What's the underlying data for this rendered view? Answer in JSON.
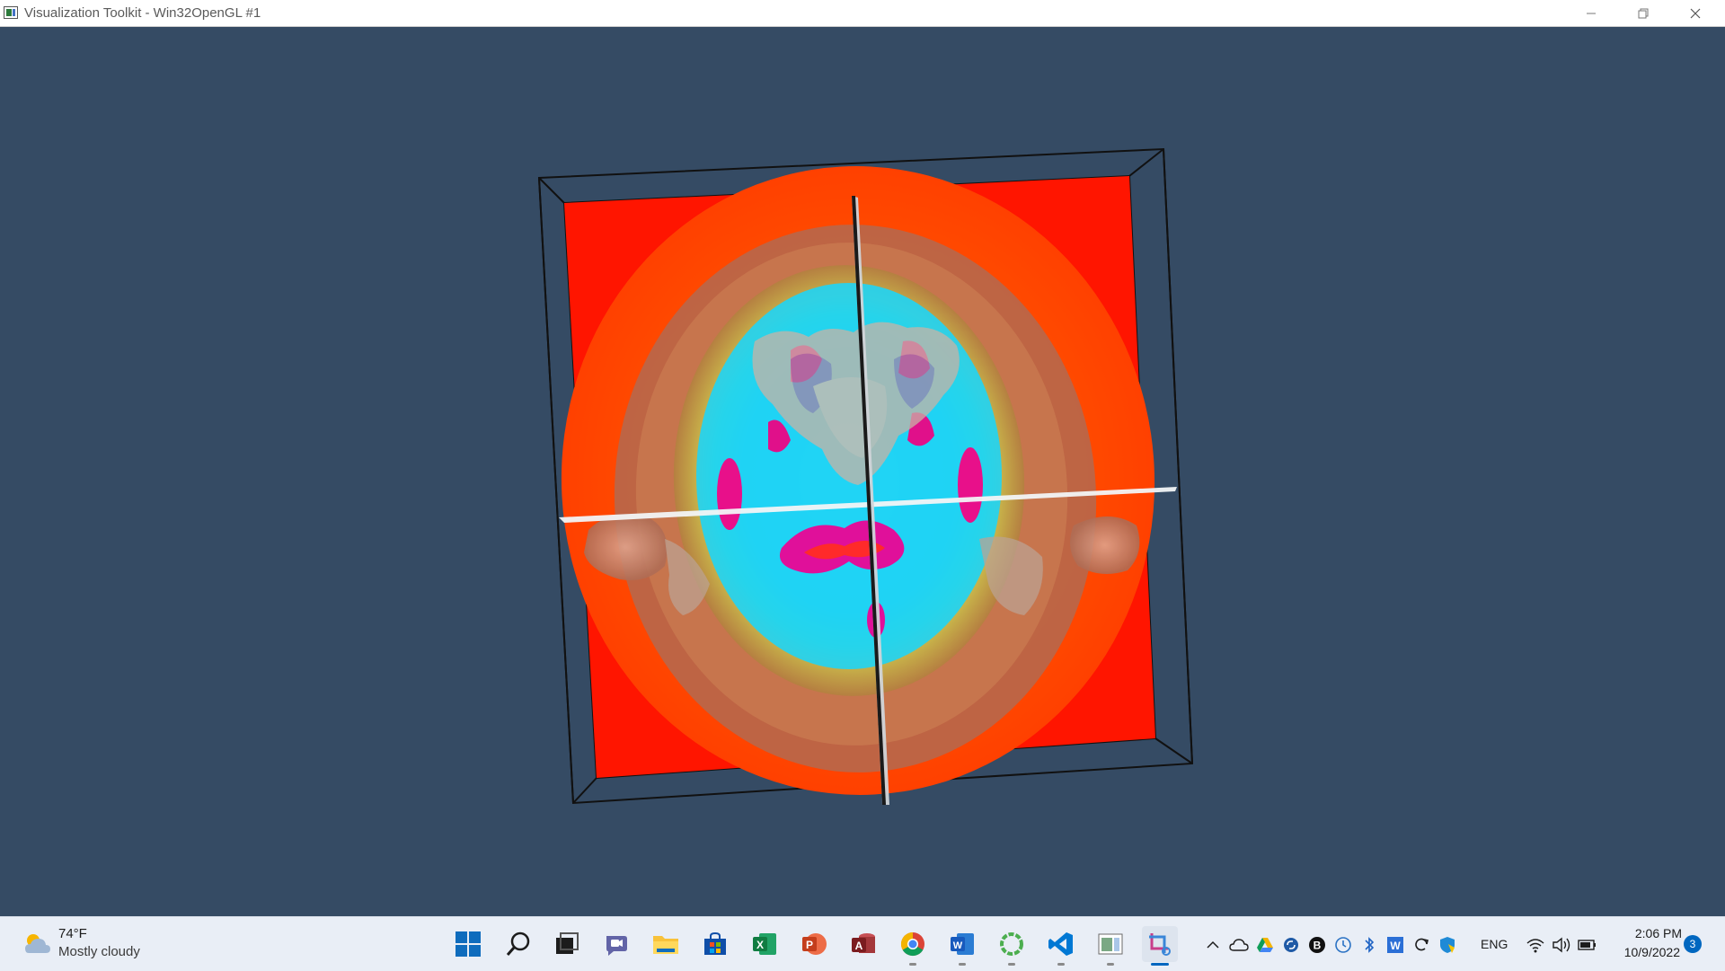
{
  "window": {
    "title": "Visualization Toolkit - Win32OpenGL #1",
    "icon": "vtk-app-icon",
    "controls": [
      "minimize-icon",
      "restore-icon",
      "close-icon"
    ]
  },
  "scene": {
    "background_color": "#354b64",
    "content": "volume rendering of head CT with color-mapped axial slice and orthogonal cutting planes",
    "colors": {
      "slice_background": "#ff1a00",
      "tissue_outer": "#ff6a00",
      "skin_surface": "#b9674a",
      "brain_cyan": "#1fd4f5",
      "ventricle_magenta": "#e0109a",
      "outline": "#111111"
    }
  },
  "taskbar": {
    "weather": {
      "temperature": "74°F",
      "condition": "Mostly cloudy",
      "icon": "partly-cloudy-icon"
    },
    "apps": [
      {
        "name": "start-icon",
        "running": false
      },
      {
        "name": "search-icon",
        "running": false
      },
      {
        "name": "task-view-icon",
        "running": false
      },
      {
        "name": "teams-chat-icon",
        "running": false
      },
      {
        "name": "file-explorer-icon",
        "running": false
      },
      {
        "name": "microsoft-store-icon",
        "running": false
      },
      {
        "name": "excel-icon",
        "running": false
      },
      {
        "name": "powerpoint-icon",
        "running": false
      },
      {
        "name": "access-icon",
        "running": false
      },
      {
        "name": "chrome-icon",
        "running": true
      },
      {
        "name": "word-icon",
        "running": true
      },
      {
        "name": "loading-app-icon",
        "running": true
      },
      {
        "name": "vscode-icon",
        "running": true
      },
      {
        "name": "vtk-window-icon",
        "running": true
      },
      {
        "name": "snipping-tool-icon",
        "running": true,
        "active": true
      }
    ],
    "tray": {
      "icons": [
        "chevron-up-icon",
        "onedrive-icon",
        "google-drive-icon",
        "sync-icon",
        "b-app-icon",
        "clock-sync-icon",
        "bluetooth-icon",
        "w-app-icon",
        "refresh-icon",
        "security-icon"
      ],
      "language": "ENG",
      "system_icons": [
        "wifi-icon",
        "volume-icon",
        "battery-icon"
      ],
      "time": "2:06 PM",
      "date": "10/9/2022",
      "notification_count": "3"
    }
  }
}
